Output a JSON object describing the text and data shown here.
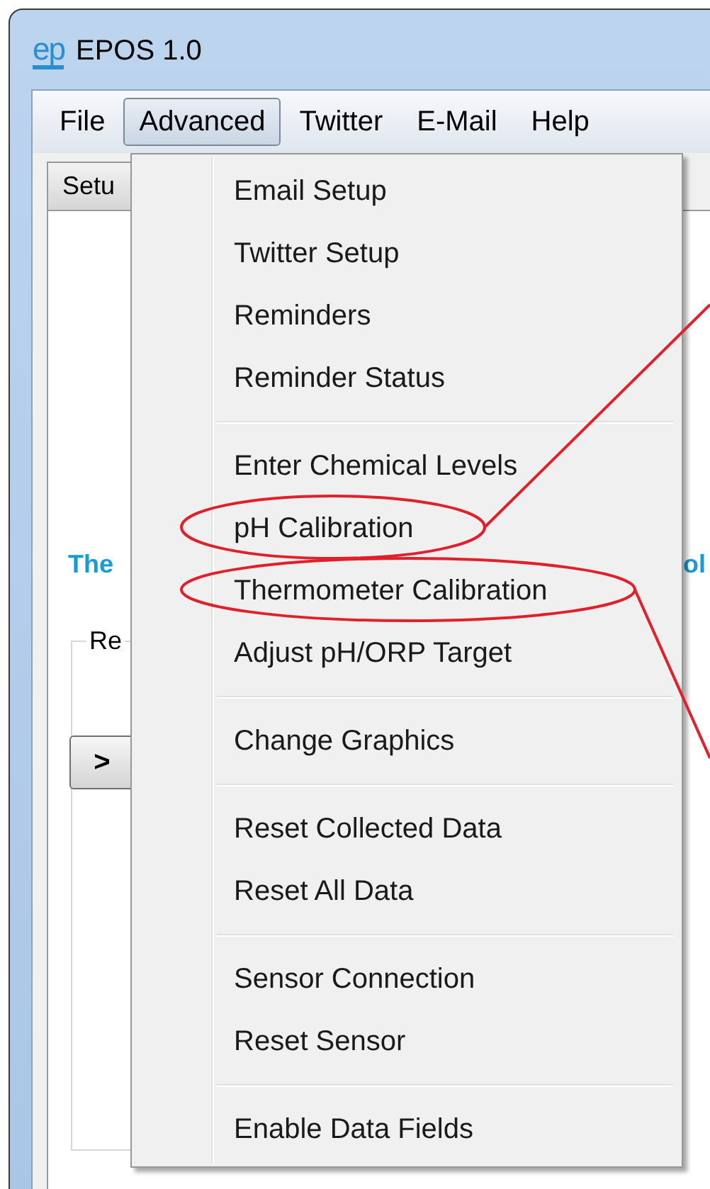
{
  "window": {
    "logo": "ep",
    "title": "EPOS 1.0"
  },
  "menu_bar": [
    {
      "label": "File",
      "selected": false
    },
    {
      "label": "Advanced",
      "selected": true
    },
    {
      "label": "Twitter",
      "selected": false
    },
    {
      "label": "E-Mail",
      "selected": false
    },
    {
      "label": "Help",
      "selected": false
    }
  ],
  "tabs": [
    {
      "label": "Setu",
      "selected": true
    }
  ],
  "heading": {
    "left": "The",
    "right": "ol"
  },
  "group": {
    "label": "Re"
  },
  "next_button": ">",
  "menu": {
    "groups": [
      [
        {
          "label": "Email Setup",
          "circled": false
        },
        {
          "label": "Twitter Setup",
          "circled": false
        },
        {
          "label": "Reminders",
          "circled": false
        },
        {
          "label": "Reminder Status",
          "circled": false
        }
      ],
      [
        {
          "label": "Enter Chemical Levels",
          "circled": false
        },
        {
          "label": "pH Calibration",
          "circled": true
        },
        {
          "label": "Thermometer Calibration",
          "circled": true
        },
        {
          "label": "Adjust pH/ORP Target",
          "circled": false
        }
      ],
      [
        {
          "label": "Change Graphics",
          "circled": false
        }
      ],
      [
        {
          "label": "Reset Collected Data",
          "circled": false
        },
        {
          "label": "Reset All Data",
          "circled": false
        }
      ],
      [
        {
          "label": "Sensor Connection",
          "circled": false
        },
        {
          "label": "Reset Sensor",
          "circled": false
        }
      ],
      [
        {
          "label": "Enable Data Fields",
          "circled": false
        }
      ]
    ]
  }
}
